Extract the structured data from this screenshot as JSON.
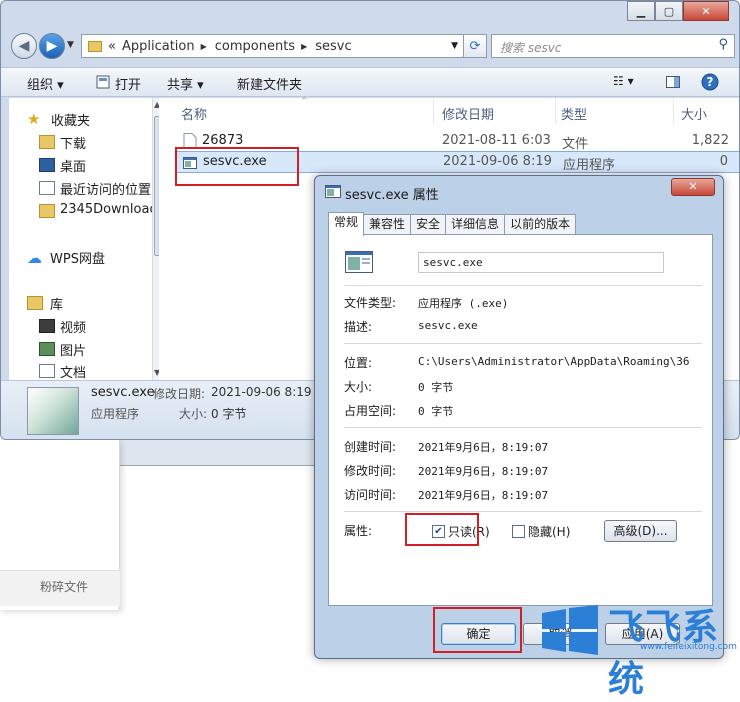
{
  "explorer": {
    "breadcrumbs": [
      "Application",
      "components",
      "sesvc"
    ],
    "crumb_prefix": "«",
    "search_placeholder": "搜索 sesvc",
    "toolbar": {
      "organize": "组织 ▾",
      "open": "打开",
      "share": "共享 ▾",
      "new_folder": "新建文件夹"
    },
    "nav": {
      "favorites": "收藏夹",
      "downloads": "下载",
      "desktop": "桌面",
      "recent": "最近访问的位置",
      "folder2345": "2345Downloac",
      "wps": "WPS网盘",
      "library": "库",
      "videos": "视频",
      "pictures": "图片",
      "documents": "文档"
    },
    "columns": {
      "name": "名称",
      "date": "修改日期",
      "type": "类型",
      "size": "大小"
    },
    "files": [
      {
        "name": "26873",
        "date": "2021-08-11 6:03",
        "type": "文件",
        "size": "1,822"
      },
      {
        "name": "sesvc.exe",
        "date": "2021-09-06 8:19",
        "type": "应用程序",
        "size": "0"
      }
    ],
    "details": {
      "name": "sesvc.exe",
      "type": "应用程序",
      "modified_label": "修改日期:",
      "modified_value": "2021-09-06 8:19",
      "size_label": "大小:",
      "size_value": "0 字节"
    }
  },
  "background": {
    "shred_button": "粉碎文件"
  },
  "dialog": {
    "title": "sesvc.exe 属性",
    "tabs": [
      "常规",
      "兼容性",
      "安全",
      "详细信息",
      "以前的版本"
    ],
    "filename": "sesvc.exe",
    "props": {
      "file_type_label": "文件类型:",
      "file_type_value": "应用程序 (.exe)",
      "desc_label": "描述:",
      "desc_value": "sesvc.exe",
      "location_label": "位置:",
      "location_value": "C:\\Users\\Administrator\\AppData\\Roaming\\36",
      "size_label": "大小:",
      "size_value": "0 字节",
      "disk_size_label": "占用空间:",
      "disk_size_value": "0 字节",
      "created_label": "创建时间:",
      "created_value": "2021年9月6日，8:19:07",
      "modified_label": "修改时间:",
      "modified_value": "2021年9月6日，8:19:07",
      "accessed_label": "访问时间:",
      "accessed_value": "2021年9月6日，8:19:07",
      "attributes_label": "属性:"
    },
    "readonly_label": "只读(R)",
    "readonly_checked": true,
    "hidden_label": "隐藏(H)",
    "hidden_checked": false,
    "advanced_button": "高级(D)...",
    "ok_button": "确定",
    "cancel_button": "取消",
    "apply_button": "应用(A)"
  },
  "watermark": {
    "text": "飞飞系统",
    "url": "www.feifeixitong.com"
  },
  "colors": {
    "highlight_red": "#d11f26",
    "selection": "#d8e8fb",
    "watermark_blue": "#2c7fd6"
  }
}
